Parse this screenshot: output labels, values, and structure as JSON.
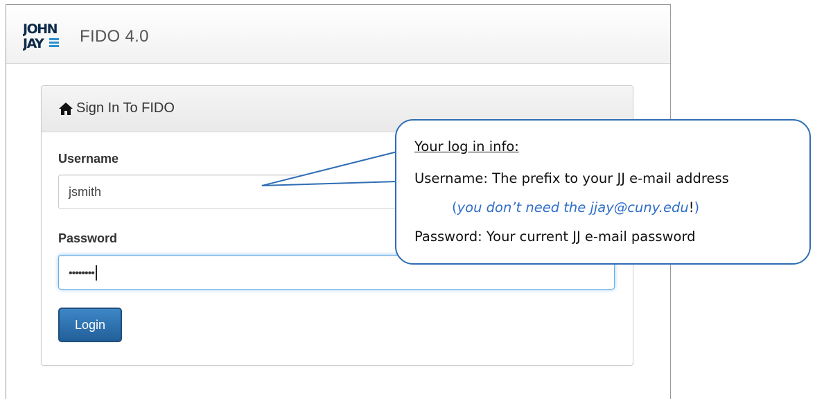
{
  "app": {
    "logo_alt": "JOHN JAY",
    "brand": "FIDO 4.0"
  },
  "panel": {
    "title": "Sign In To FIDO",
    "icon": "home-icon"
  },
  "form": {
    "username_label": "Username",
    "username_value": "jsmith",
    "password_label": "Password",
    "password_value": "••••••••",
    "login_label": "Login"
  },
  "callout": {
    "heading": "Your log in info:",
    "line1": "Username: The prefix to your JJ e-mail address",
    "note_open": "(",
    "note_italic": "you don’t need the jjay@cuny.edu",
    "note_excl": "!",
    "note_close": ")",
    "line2": "Password: Your current JJ e-mail password"
  },
  "colors": {
    "accent": "#2e6db4",
    "button": "#2a6aa8",
    "note": "#2f6ec9"
  }
}
